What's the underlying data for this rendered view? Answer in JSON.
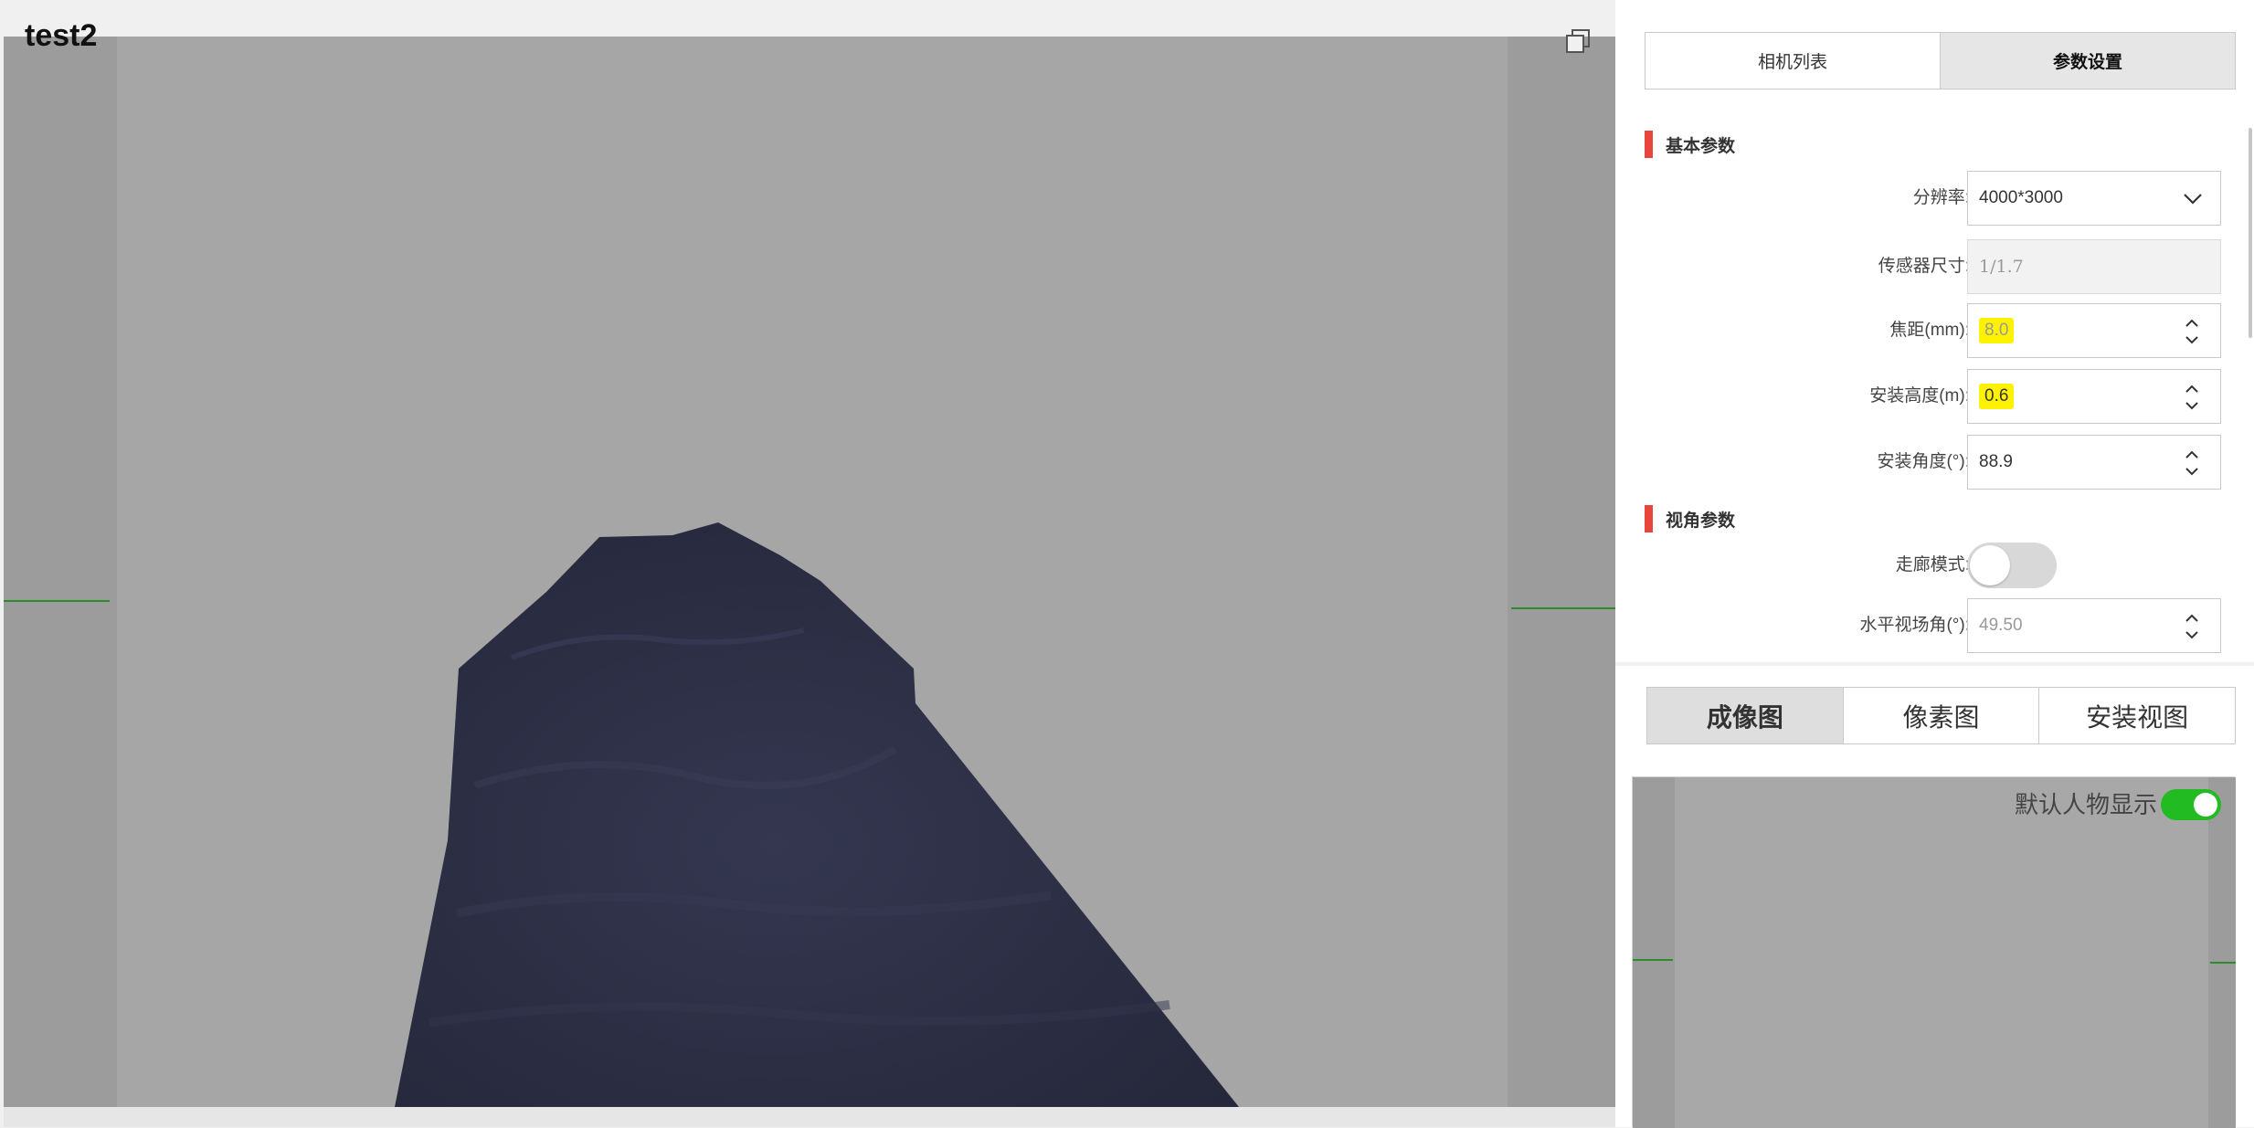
{
  "viewport": {
    "title": "test2"
  },
  "panel": {
    "tabs": [
      {
        "label": "相机列表",
        "active": false
      },
      {
        "label": "参数设置",
        "active": true
      }
    ],
    "sections": {
      "basic": "基本参数",
      "view": "视角参数"
    },
    "fields": {
      "resolution": {
        "label": "分辨率:",
        "value": "4000*3000"
      },
      "sensor_size": {
        "label": "传感器尺寸:",
        "value": "1/1.7"
      },
      "focal_length": {
        "label": "焦距(mm):",
        "value": "8.0"
      },
      "mount_height": {
        "label": "安装高度(m):",
        "value": "0.6"
      },
      "mount_angle": {
        "label": "安装角度(°):",
        "value": "88.9"
      },
      "corridor_mode": {
        "label": "走廊模式:",
        "on": false
      },
      "hfov": {
        "label": "水平视场角(°):",
        "value": "49.50"
      }
    },
    "view_tabs": [
      {
        "label": "成像图",
        "active": true
      },
      {
        "label": "像素图",
        "active": false
      },
      {
        "label": "安装视图",
        "active": false
      }
    ],
    "preview": {
      "toggle_label": "默认人物显示",
      "toggle_on": true
    }
  },
  "colors": {
    "accent_red": "#e8453c",
    "toggle_on": "#22bb22",
    "highlight": "#fff200",
    "mesh": "#2d2f45"
  },
  "icons": {
    "copy": "copy-icon",
    "dropdown": "chevron-down-icon",
    "spinner": "spinner-arrows-icon"
  }
}
